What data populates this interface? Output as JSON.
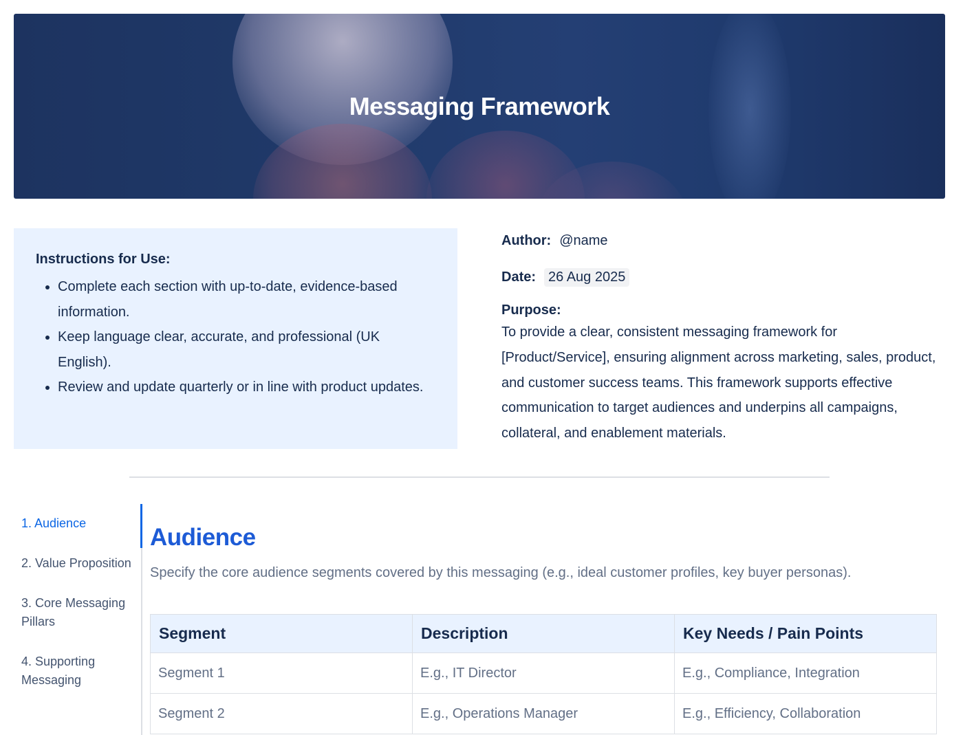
{
  "banner": {
    "title": "Messaging Framework"
  },
  "instructions": {
    "heading": "Instructions for Use:",
    "items": [
      "Complete each section with up-to-date, evidence-based information.",
      "Keep language clear, accurate, and professional (UK English).",
      "Review and update quarterly or in line with product updates."
    ]
  },
  "meta": {
    "author_label": "Author:",
    "author_value": "@name",
    "date_label": "Date:",
    "date_value": "26 Aug 2025",
    "purpose_label": "Purpose:",
    "purpose_text": "To provide a clear, consistent messaging framework for [Product/Service], ensuring alignment across marketing, sales, product, and customer success teams. This framework supports effective communication to target audiences and underpins all campaigns, collateral, and enablement materials."
  },
  "toc": {
    "items": [
      {
        "label": "1. Audience",
        "active": true
      },
      {
        "label": "2. Value Proposition",
        "active": false
      },
      {
        "label": "3. Core Messaging Pillars",
        "active": false
      },
      {
        "label": "4. Supporting Messaging",
        "active": false
      }
    ]
  },
  "section": {
    "title": "Audience",
    "description": "Specify the core audience segments covered by this messaging (e.g., ideal customer profiles, key buyer personas).",
    "table": {
      "headers": [
        "Segment",
        "Description",
        "Key Needs / Pain Points"
      ],
      "rows": [
        [
          "Segment 1",
          "E.g., IT Director",
          "E.g., Compliance, Integration"
        ],
        [
          "Segment 2",
          "E.g., Operations Manager",
          "E.g., Efficiency, Collaboration"
        ]
      ]
    }
  },
  "colors": {
    "accent": "#0c66e4",
    "heading": "#1d5bd6",
    "panel_bg": "#e9f2ff",
    "muted_text": "#626f86",
    "banner_bg": "#203a6a"
  }
}
